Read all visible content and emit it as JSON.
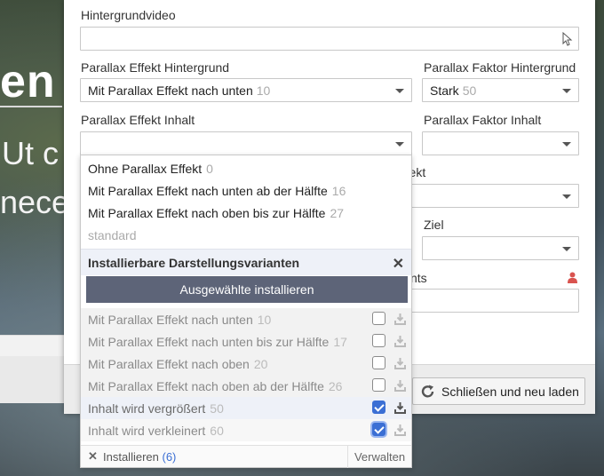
{
  "background": {
    "heading": "en",
    "line1": "Ut c",
    "line2": "nece"
  },
  "form": {
    "hintergrundvideo_label": "Hintergrundvideo",
    "hintergrundvideo_value": "",
    "parallax_bg_label": "Parallax Effekt Hintergrund",
    "parallax_bg_value": "Mit Parallax Effekt nach unten",
    "parallax_bg_count": "10",
    "parallax_bg_factor_label": "Parallax Faktor Hintergrund",
    "parallax_bg_factor_value": "Stark",
    "parallax_bg_factor_count": "50",
    "parallax_content_label": "Parallax Effekt Inhalt",
    "parallax_content_value": "",
    "parallax_content_factor_label": "Parallax Faktor Inhalt",
    "effect_label_partial": "ffekt",
    "ziel_label": "Ziel",
    "nts_label_partial": "nts"
  },
  "dropdown": {
    "options": [
      {
        "label": "Ohne Parallax Effekt",
        "count": "0"
      },
      {
        "label": "Mit Parallax Effekt nach unten ab der Hälfte",
        "count": "16"
      },
      {
        "label": "Mit Parallax Effekt nach oben bis zur Hälfte",
        "count": "27"
      }
    ],
    "standard": "standard",
    "section_title": "Installierbare Darstellungsvarianten",
    "install_selected": "Ausgewählte installieren",
    "variants": [
      {
        "label": "Mit Parallax Effekt nach unten",
        "count": "10",
        "checked": false
      },
      {
        "label": "Mit Parallax Effekt nach unten bis zur Hälfte",
        "count": "17",
        "checked": false
      },
      {
        "label": "Mit Parallax Effekt nach oben",
        "count": "20",
        "checked": false
      },
      {
        "label": "Mit Parallax Effekt nach oben ab der Hälfte",
        "count": "26",
        "checked": false
      },
      {
        "label": "Inhalt wird vergrößert",
        "count": "50",
        "checked": true
      },
      {
        "label": "Inhalt wird verkleinert",
        "count": "60",
        "checked": true
      }
    ],
    "footer_install": "Installieren",
    "footer_install_count": "(6)",
    "footer_manage": "Verwalten"
  },
  "footer": {
    "reload_label": "Schließen und neu laden"
  },
  "colors": {
    "accent": "#3b6fd4",
    "install_button": "#5d6478",
    "person_icon": "#d9534f"
  }
}
